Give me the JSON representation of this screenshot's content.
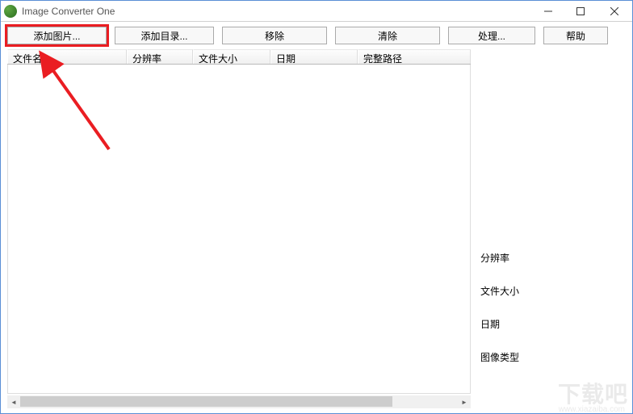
{
  "window": {
    "title": "Image Converter One"
  },
  "toolbar": {
    "add_image": "添加图片...",
    "add_folder": "添加目录...",
    "remove": "移除",
    "clear": "清除",
    "process": "处理...",
    "help": "帮助"
  },
  "table": {
    "columns": {
      "filename": "文件名",
      "resolution": "分辨率",
      "filesize": "文件大小",
      "date": "日期",
      "fullpath": "完整路径"
    },
    "rows": []
  },
  "info_panel": {
    "resolution": "分辨率",
    "filesize": "文件大小",
    "date": "日期",
    "image_type": "图像类型"
  },
  "watermark": {
    "text": "下载吧",
    "url": "www.xiazaiba.com"
  },
  "annotation": {
    "highlight_color": "#ea1d22"
  }
}
